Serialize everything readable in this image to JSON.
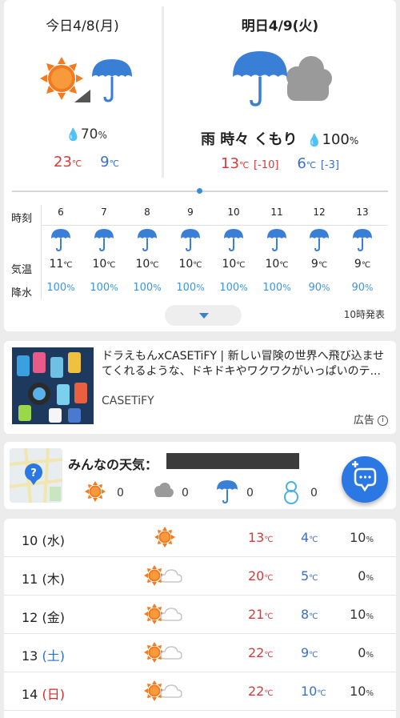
{
  "today": {
    "title": "今日4/8(月)",
    "pop": "70",
    "pct": "%",
    "high": "23",
    "low": "9",
    "unit": "℃",
    "icon": "sun-then-umbrella-icon"
  },
  "tomorrow": {
    "title": "明日4/9(火)",
    "weather": "雨 時々 くもり",
    "pop": "100",
    "pct": "%",
    "high": "13",
    "high_diff": "[-10]",
    "low": "6",
    "low_diff": "[-3]",
    "unit": "℃",
    "icon": "umbrella-with-cloud-icon"
  },
  "hourly": {
    "label_time": "時刻",
    "label_temp": "気温",
    "label_rain": "降水",
    "unit": "℃",
    "pct": "%",
    "issued": "10時発表",
    "hours": [
      {
        "hour": "6",
        "temp": "11",
        "rain": "100"
      },
      {
        "hour": "7",
        "temp": "10",
        "rain": "100"
      },
      {
        "hour": "8",
        "temp": "10",
        "rain": "100"
      },
      {
        "hour": "9",
        "temp": "10",
        "rain": "100"
      },
      {
        "hour": "10",
        "temp": "10",
        "rain": "100"
      },
      {
        "hour": "11",
        "temp": "10",
        "rain": "100"
      },
      {
        "hour": "12",
        "temp": "9",
        "rain": "90"
      },
      {
        "hour": "13",
        "temp": "9",
        "rain": "90"
      }
    ]
  },
  "ad": {
    "text": "ドラえもんxCASETiFY | 新しい冒険の世界へ飛び込ませてくれるような、ドキドキやワクワクがいっぱいのテ...",
    "brand": "CASETiFY",
    "label": "広告"
  },
  "community": {
    "title": "みんなの天気：",
    "counts": [
      {
        "icon": "sun-icon",
        "count": "0"
      },
      {
        "icon": "cloud-icon",
        "count": "0"
      },
      {
        "icon": "umbrella-icon",
        "count": "0"
      },
      {
        "icon": "snowman-icon",
        "count": "0"
      }
    ]
  },
  "weekly": {
    "unit": "℃",
    "pct": "%",
    "days": [
      {
        "date": "10",
        "dow": "(水)",
        "icon": "sun-icon",
        "high": "13",
        "low": "4",
        "pop": "10"
      },
      {
        "date": "11",
        "dow": "(木)",
        "icon": "sun-cloud-icon",
        "high": "20",
        "low": "5",
        "pop": "0"
      },
      {
        "date": "12",
        "dow": "(金)",
        "icon": "sun-cloud-icon",
        "high": "21",
        "low": "8",
        "pop": "10"
      },
      {
        "date": "13",
        "dow": "(土)",
        "icon": "sun-cloud-icon",
        "high": "22",
        "low": "9",
        "pop": "0"
      },
      {
        "date": "14",
        "dow": "(日)",
        "icon": "sun-cloud-icon",
        "high": "22",
        "low": "10",
        "pop": "10"
      }
    ]
  },
  "colors": {
    "high": "#d83a3a",
    "low": "#3a6fcc",
    "rain": "#3a95e4",
    "accent": "#2b78e4",
    "sun": "#f47a20"
  }
}
